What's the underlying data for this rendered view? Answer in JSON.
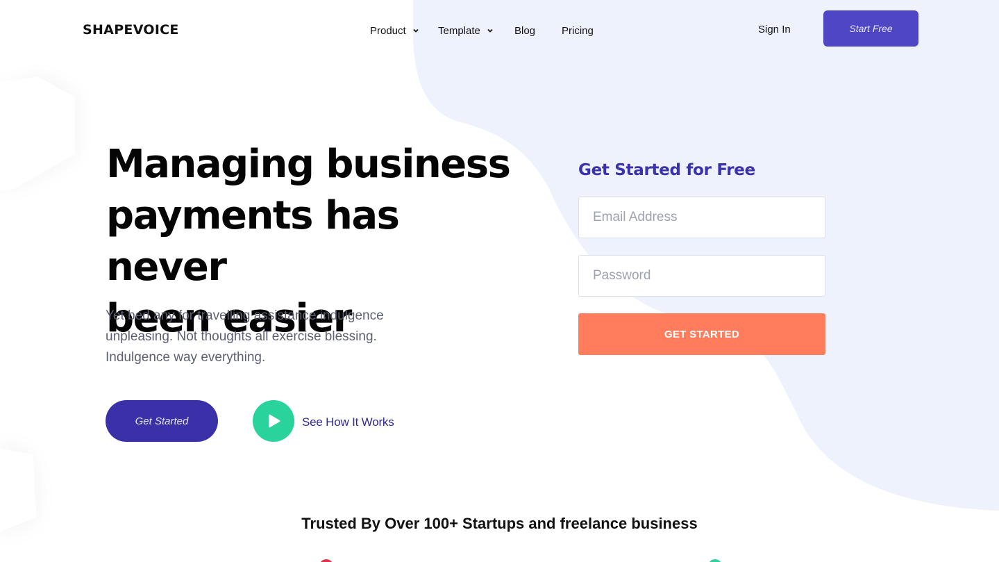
{
  "header": {
    "logo": "SHAPEVOICE",
    "nav": [
      {
        "label": "Product",
        "has_dropdown": true
      },
      {
        "label": "Template",
        "has_dropdown": true
      },
      {
        "label": "Blog",
        "has_dropdown": false
      },
      {
        "label": "Pricing",
        "has_dropdown": false
      }
    ],
    "sign_in": "Sign In",
    "start_free": "Start Free"
  },
  "hero": {
    "title_lines": [
      "Managing business",
      "payments has never",
      "been easier"
    ],
    "subtitle": "Yet bed any for travelling assistance indulgence unpleasing. Not thoughts all exercise blessing. Indulgence way everything.",
    "cta_primary": "Get Started",
    "cta_secondary": "See How It Works"
  },
  "signup_form": {
    "title": "Get Started for Free",
    "email_placeholder": "Email Address",
    "password_placeholder": "Password",
    "submit": "GET STARTED"
  },
  "trusted": {
    "text": "Trusted By Over 100+ Startups and freelance business"
  },
  "icons": {
    "play": "play-icon",
    "chevron": "chevron-down-icon"
  },
  "colors": {
    "brand": "#3a31a8",
    "start_free_bg": "#4f46c6",
    "accent_orange": "#ff7d5c",
    "accent_green": "#2ad39b",
    "blob_bg": "#eef2fd",
    "form_title": "#3a33ad"
  }
}
